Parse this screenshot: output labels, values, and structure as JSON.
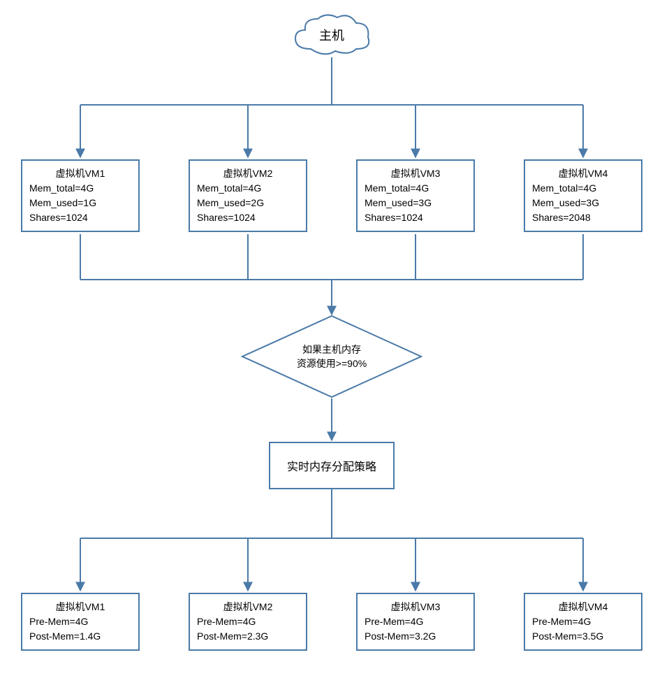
{
  "host": {
    "label": "主机"
  },
  "vms_top": [
    {
      "name": "虚拟机VM1",
      "mem_total": "Mem_total=4G",
      "mem_used": "Mem_used=1G",
      "shares": "Shares=1024"
    },
    {
      "name": "虚拟机VM2",
      "mem_total": "Mem_total=4G",
      "mem_used": "Mem_used=2G",
      "shares": "Shares=1024"
    },
    {
      "name": "虚拟机VM3",
      "mem_total": "Mem_total=4G",
      "mem_used": "Mem_used=3G",
      "shares": "Shares=1024"
    },
    {
      "name": "虚拟机VM4",
      "mem_total": "Mem_total=4G",
      "mem_used": "Mem_used=3G",
      "shares": "Shares=2048"
    }
  ],
  "decision": {
    "line1": "如果主机内存",
    "line2": "资源使用>=90%"
  },
  "policy": {
    "label": "实时内存分配策略"
  },
  "vms_bottom": [
    {
      "name": "虚拟机VM1",
      "pre": "Pre-Mem=4G",
      "post": "Post-Mem=1.4G"
    },
    {
      "name": "虚拟机VM2",
      "pre": "Pre-Mem=4G",
      "post": "Post-Mem=2.3G"
    },
    {
      "name": "虚拟机VM3",
      "pre": "Pre-Mem=4G",
      "post": "Post-Mem=3.2G"
    },
    {
      "name": "虚拟机VM4",
      "pre": "Pre-Mem=4G",
      "post": "Post-Mem=3.5G"
    }
  ],
  "chart_data": {
    "type": "table",
    "title": "Virtual Machine Memory Allocation Diagram",
    "host_label": "主机",
    "decision_condition": "如果主机内存资源使用>=90%",
    "policy_label": "实时内存分配策略",
    "vms_initial": [
      {
        "vm": "VM1",
        "mem_total_gb": 4,
        "mem_used_gb": 1,
        "shares": 1024
      },
      {
        "vm": "VM2",
        "mem_total_gb": 4,
        "mem_used_gb": 2,
        "shares": 1024
      },
      {
        "vm": "VM3",
        "mem_total_gb": 4,
        "mem_used_gb": 3,
        "shares": 1024
      },
      {
        "vm": "VM4",
        "mem_total_gb": 4,
        "mem_used_gb": 3,
        "shares": 2048
      }
    ],
    "vms_after_policy": [
      {
        "vm": "VM1",
        "pre_mem_gb": 4,
        "post_mem_gb": 1.4
      },
      {
        "vm": "VM2",
        "pre_mem_gb": 4,
        "post_mem_gb": 2.3
      },
      {
        "vm": "VM3",
        "pre_mem_gb": 4,
        "post_mem_gb": 3.2
      },
      {
        "vm": "VM4",
        "pre_mem_gb": 4,
        "post_mem_gb": 3.5
      }
    ]
  }
}
